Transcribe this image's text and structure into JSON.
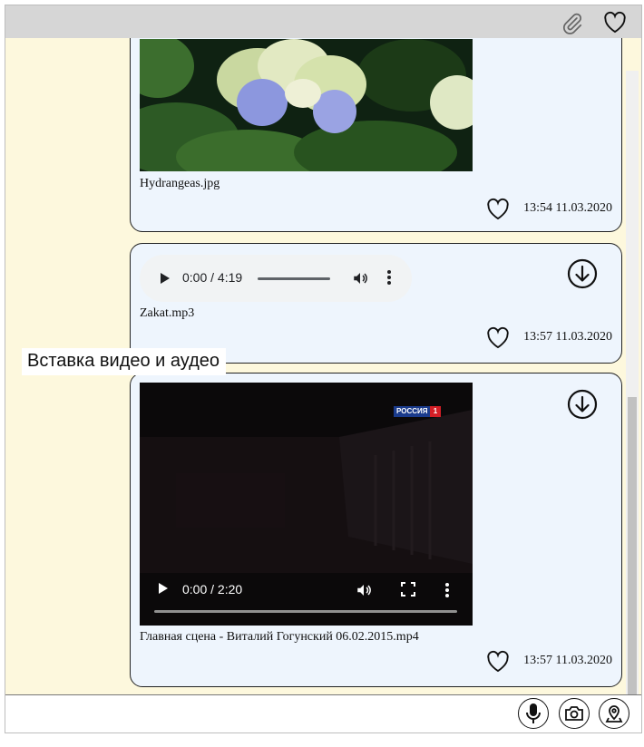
{
  "toolbar": {
    "attach_icon": "paperclip-icon",
    "favorite_icon": "heart-icon"
  },
  "messages": [
    {
      "type": "image",
      "file_name": "Hydrangeas.jpg",
      "time": "13:54 11.03.2020"
    },
    {
      "type": "audio",
      "file_name": "Zakat.mp3",
      "time": "13:57 11.03.2020",
      "player": {
        "position": "0:00",
        "duration": "4:19",
        "display": "0:00 / 4:19"
      }
    },
    {
      "type": "video",
      "file_name": "Главная сцена - Виталий Гогунский 06.02.2015.mp4",
      "time": "13:57 11.03.2020",
      "player": {
        "position": "0:00",
        "duration": "2:20",
        "display": "0:00 / 2:20",
        "channel_badge": "РОССИЯ",
        "channel_number": "1"
      }
    }
  ],
  "caption": "Вставка видео и аудео",
  "input": {
    "value": "",
    "placeholder": ""
  },
  "actions": {
    "mic_icon": "microphone-icon",
    "camera_icon": "camera-icon",
    "location_icon": "location-pin-icon"
  },
  "colors": {
    "chat_background": "#fdf8dd",
    "bubble": "#eef5fd",
    "toolbar": "#d6d6d6"
  }
}
